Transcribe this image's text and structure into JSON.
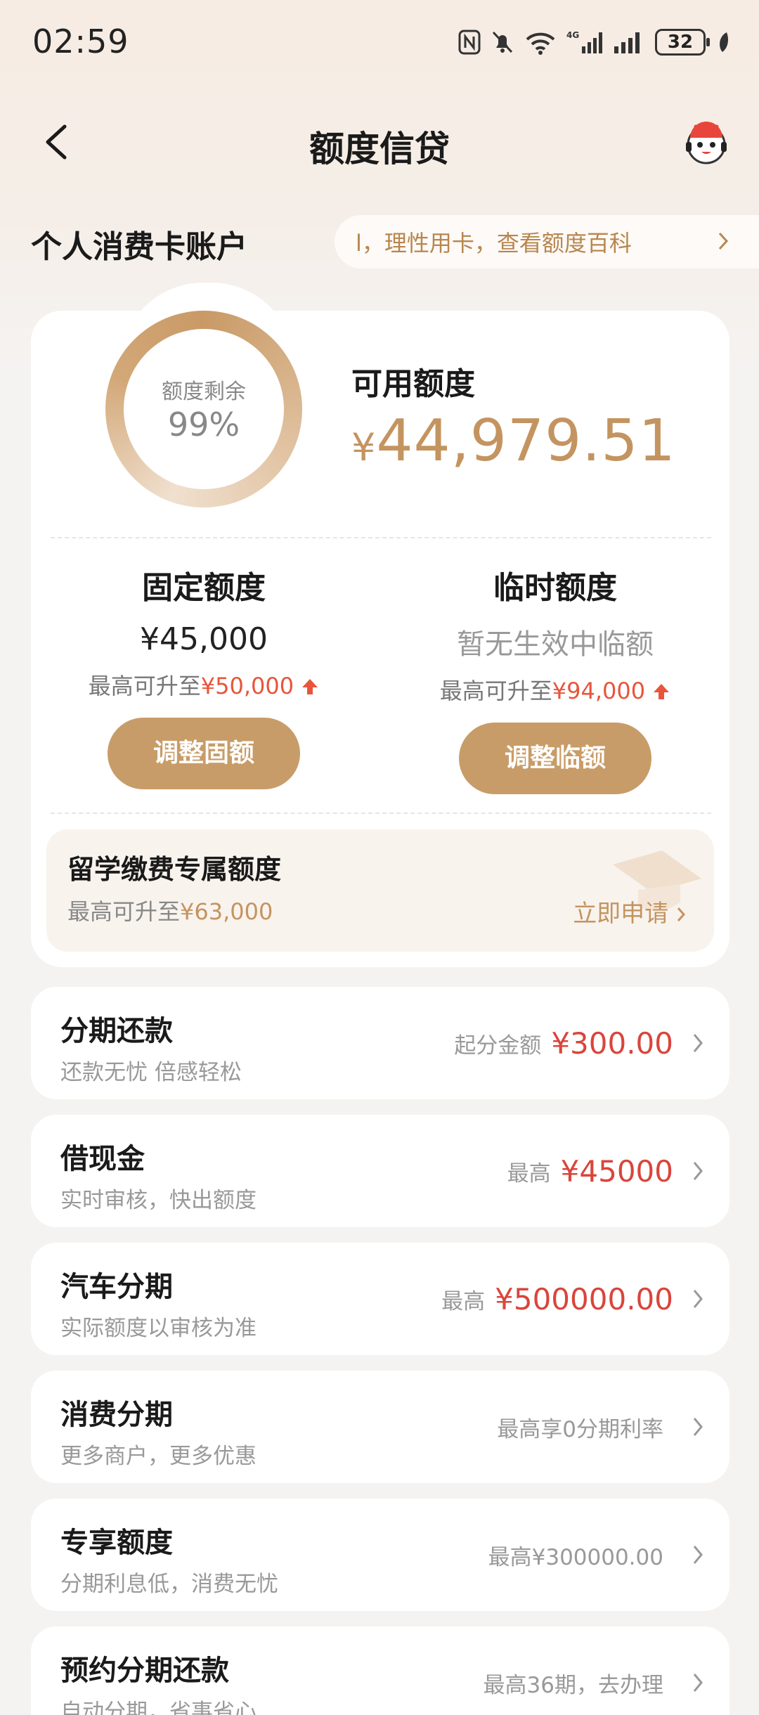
{
  "status_bar": {
    "time": "02:59",
    "battery": "32"
  },
  "nav": {
    "title": "额度信贷"
  },
  "account": {
    "title": "个人消费卡账户",
    "tips": "l，理性用卡，查看额度百科"
  },
  "summary": {
    "remain_label": "额度剩余",
    "remain_percent": "99%",
    "available_label": "可用额度",
    "available_currency": "¥",
    "available_amount": "44,979.51"
  },
  "fixed": {
    "title": "固定额度",
    "value": "¥45,000",
    "upgrade_prefix": "最高可升至",
    "upgrade_amount": "¥50,000",
    "button": "调整固额"
  },
  "temp": {
    "title": "临时额度",
    "value": "暂无生效中临额",
    "upgrade_prefix": "最高可升至",
    "upgrade_amount": "¥94,000",
    "button": "调整临额"
  },
  "study": {
    "title": "留学缴费专属额度",
    "prefix": "最高可升至",
    "amount": "¥63,000",
    "apply": "立即申请"
  },
  "services": [
    {
      "title": "分期还款",
      "subtitle": "还款无忧 倍感轻松",
      "right_label": "起分金额",
      "right_amount": "¥300.00"
    },
    {
      "title": "借现金",
      "subtitle": "实时审核，快出额度",
      "right_label": "最高",
      "right_amount": "¥45000"
    },
    {
      "title": "汽车分期",
      "subtitle": "实际额度以审核为准",
      "right_label": "最高",
      "right_amount": "¥500000.00"
    },
    {
      "title": "消费分期",
      "subtitle": "更多商户，更多优惠",
      "right_label": "最高享0分期利率",
      "right_amount": ""
    },
    {
      "title": "专享额度",
      "subtitle": "分期利息低，消费无忧",
      "right_label": "最高¥300000.00",
      "right_amount": ""
    },
    {
      "title": "预约分期还款",
      "subtitle": "自动分期，省事省心",
      "right_label": "最高36期，去办理",
      "right_amount": ""
    }
  ],
  "colors": {
    "accent": "#c49460",
    "button": "#c89c68",
    "highlight": "#e8553b",
    "amount_red": "#d9453c"
  }
}
